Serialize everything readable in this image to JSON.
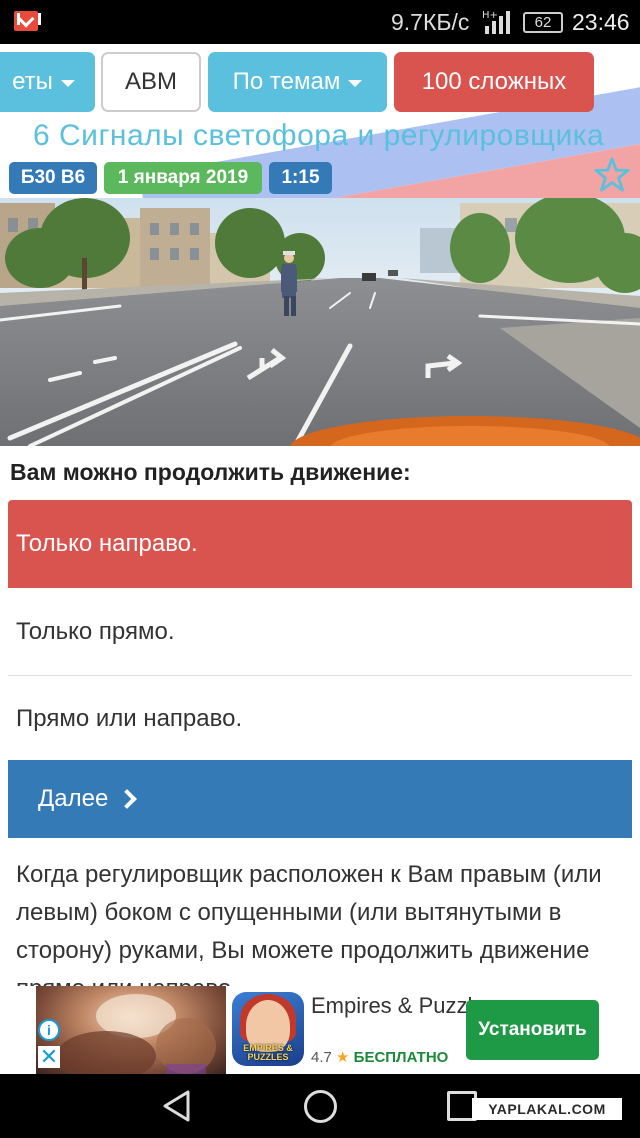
{
  "status_bar": {
    "speed": "9.7КБ/с",
    "network": "H+",
    "battery": "62",
    "time": "23:46"
  },
  "nav": {
    "tickets_label": "еты",
    "category_label": "ABM",
    "topics_label": "По темам",
    "hard_label": "100 сложных"
  },
  "page": {
    "title": "6 Сигналы светофора и регулировщика",
    "ticket_tag": "Б30 В6",
    "date_tag": "1 января 2019",
    "time_tag": "1:15"
  },
  "question": {
    "text": "Вам можно продолжить движение:",
    "answers": [
      {
        "label": "Только направо.",
        "state": "wrong"
      },
      {
        "label": "Только прямо.",
        "state": "none"
      },
      {
        "label": "Прямо или направо.",
        "state": "none"
      }
    ],
    "next_label": "Далее"
  },
  "explanation": {
    "text": "Когда регулировщик расположен к Вам правым (или левым) боком с опущенными (или вытянутыми в сторону) руками, Вы можете продолжить движение прямо или направо."
  },
  "ad": {
    "app_name": "Empires & Puzzles",
    "icon_logo": "EMPIRES & PUZZLES",
    "rating": "4.7",
    "price": "БЕСПЛАТНО",
    "install_label": "Установить"
  },
  "watermark": "YAPLAKAL.COM",
  "colors": {
    "info": "#5bc0de",
    "primary": "#337ab7",
    "success": "#5cb85c",
    "danger": "#d9534f",
    "install": "#1e9a46"
  }
}
